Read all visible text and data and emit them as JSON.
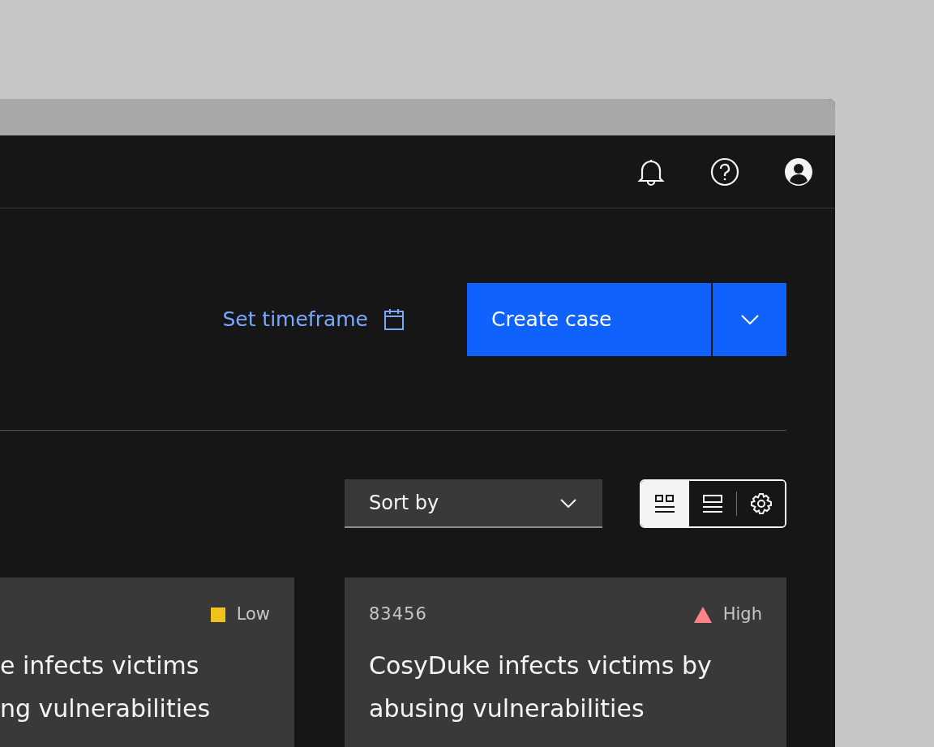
{
  "actions": {
    "timeframe_link": "Set timeframe",
    "primary_button": "Create case"
  },
  "toolbar": {
    "sort_dropdown": {
      "label": "Sort by"
    },
    "view_toggle": [
      {
        "kind": "grid",
        "selected": true
      },
      {
        "kind": "list",
        "selected": false
      }
    ]
  },
  "cards": [
    {
      "severity": "Low",
      "kind": "square",
      "color": "#f1c21b",
      "title": "e infects victims ng vulnerabilities"
    },
    {
      "id": "83456",
      "severity": "High",
      "kind": "triangle",
      "color": "#ff8389",
      "title": "CosyDuke infects victims by abusing vulnerabilities"
    }
  ]
}
